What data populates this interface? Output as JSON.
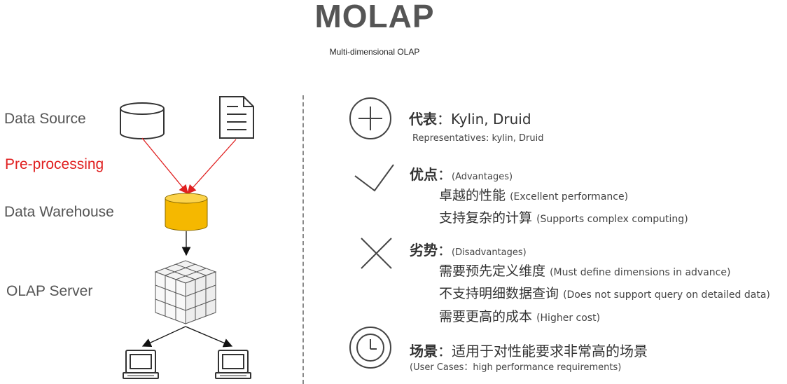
{
  "header": {
    "title": "MOLAP",
    "subtitle": "Multi-dimensional OLAP"
  },
  "diagram": {
    "data_source": "Data Source",
    "pre_processing": "Pre-processing",
    "data_warehouse": "Data Warehouse",
    "olap_server": "OLAP Server"
  },
  "representatives": {
    "label": "代表",
    "sep": "：",
    "value": "Kylin, Druid",
    "note": "Representatives: kylin, Druid",
    "icon": "plus-circle-icon"
  },
  "advantages": {
    "label": "优点",
    "sep": "：",
    "note": "(Advantages)",
    "icon": "check-icon",
    "items": [
      {
        "zh": "卓越的性能",
        "en": "(Excellent performance)"
      },
      {
        "zh": "支持复杂的计算",
        "en": "(Supports complex computing)"
      }
    ]
  },
  "disadvantages": {
    "label": "劣势",
    "sep": "：",
    "note": "(Disadvantages)",
    "icon": "cross-icon",
    "items": [
      {
        "zh": "需要预先定义维度",
        "en": "(Must define dimensions in advance)"
      },
      {
        "zh": "不支持明细数据查询",
        "en": "(Does not support query on detailed data)"
      },
      {
        "zh": "需要更高的成本",
        "en": "(Higher cost)"
      }
    ]
  },
  "use_cases": {
    "label": "场景",
    "sep": "：",
    "value": "适用于对性能要求非常高的场景",
    "note": "(User Cases：high performance requirements)",
    "icon": "clock-icon"
  },
  "colors": {
    "arrow_red": "#e02020",
    "warehouse_fill": "#f5b800",
    "text_gray": "#555555"
  }
}
